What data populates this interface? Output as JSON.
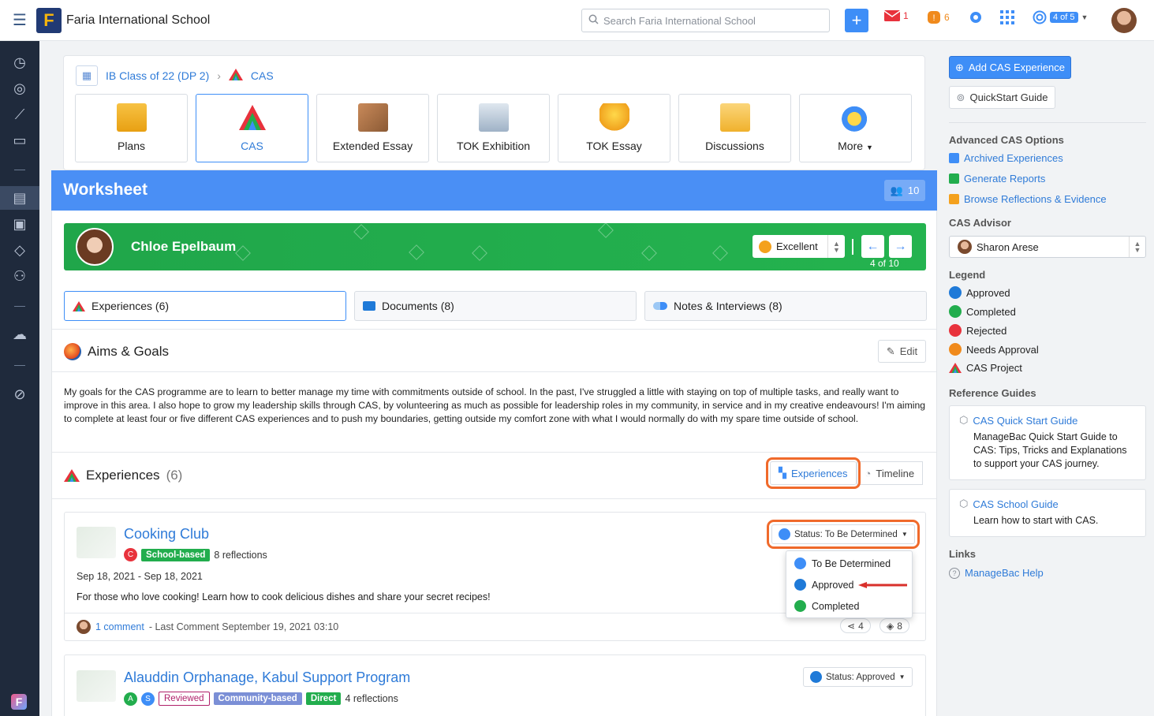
{
  "topbar": {
    "school_name": "Faria International School",
    "search_placeholder": "Search Faria International School",
    "mail_count": "1",
    "notif_count": "6",
    "page_indicator": "4 of 5"
  },
  "breadcrumb": {
    "class": "IB Class of 22 (DP 2)",
    "section": "CAS"
  },
  "tiles": [
    "Plans",
    "CAS",
    "Extended Essay",
    "TOK Exhibition",
    "TOK Essay",
    "Discussions",
    "More"
  ],
  "worksheet": {
    "title": "Worksheet",
    "count": "10"
  },
  "student": {
    "name": "Chloe Epelbaum",
    "grade": "Excellent",
    "position": "4 of 10"
  },
  "subtabs": [
    "Experiences (6)",
    "Documents (8)",
    "Notes & Interviews (8)"
  ],
  "aims": {
    "title": "Aims & Goals",
    "edit_label": "Edit",
    "text": "My goals for the CAS programme are to learn to better manage my time with commitments outside of school. In the past, I've struggled a little with staying on top of multiple tasks, and really want to improve in this area. I also hope to grow my leadership skills through CAS, by volunteering as much as possible for leadership roles in my community, in service and in my creative endeavours! I'm aiming to complete at least four or five different CAS experiences and to push my boundaries, getting outside my comfort zone with what I would normally do with my spare time outside of school."
  },
  "experiences": {
    "title": "Experiences",
    "count": "(6)",
    "view_experiences": "Experiences",
    "view_timeline": "Timeline",
    "items": [
      {
        "title": "Cooking Club",
        "dots": [
          "C"
        ],
        "tags": [
          "School-based"
        ],
        "reflections": "8 reflections",
        "dates": "Sep 18, 2021 - Sep 18, 2021",
        "description": "For those who love cooking! Learn how to cook delicious dishes and share your secret recipes!",
        "comment_link": "1 comment",
        "last_comment": "- Last Comment September 19, 2021 03:10",
        "share_count": "4",
        "layer_count": "8",
        "status": "Status: To Be Determined"
      },
      {
        "title": "Alauddin Orphanage, Kabul Support Program",
        "dots": [
          "A",
          "S"
        ],
        "tags": [
          "Reviewed",
          "Community-based",
          "Direct"
        ],
        "reflections": "4 reflections",
        "status": "Status: Approved"
      }
    ],
    "status_options": [
      "To Be Determined",
      "Approved",
      "Completed"
    ]
  },
  "right_panel": {
    "add_button": "Add CAS Experience",
    "quickstart_button": "QuickStart Guide",
    "advanced_heading": "Advanced CAS Options",
    "advanced_links": [
      "Archived Experiences",
      "Generate Reports",
      "Browse Reflections & Evidence"
    ],
    "advisor_heading": "CAS Advisor",
    "advisor_name": "Sharon Arese",
    "legend_heading": "Legend",
    "legend": [
      "Approved",
      "Completed",
      "Rejected",
      "Needs Approval",
      "CAS Project"
    ],
    "guides_heading": "Reference Guides",
    "guides": [
      {
        "title": "CAS Quick Start Guide",
        "desc": "ManageBac Quick Start Guide to CAS: Tips, Tricks and Explanations to support your CAS journey."
      },
      {
        "title": "CAS School Guide",
        "desc": "Learn how to start with CAS."
      }
    ],
    "links_heading": "Links",
    "links": [
      "ManageBac Help"
    ]
  },
  "colors": {
    "primary": "#3e8ef7",
    "worksheet_header": "#4a8ff5",
    "student_bar": "#22ad4d",
    "highlight": "#f06a2b",
    "sidebar": "#1f2a3c"
  }
}
